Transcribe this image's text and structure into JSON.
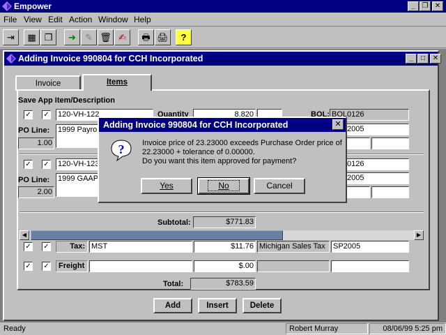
{
  "app": {
    "title": "Empower",
    "window_buttons": [
      "_",
      "❐",
      "✕"
    ]
  },
  "menu": [
    "File",
    "View",
    "Edit",
    "Action",
    "Window",
    "Help"
  ],
  "toolbar": {
    "buttons": [
      {
        "name": "exit-icon",
        "glyph": "⇥"
      },
      {
        "name": "grid-icon",
        "glyph": "▦"
      },
      {
        "name": "windows-icon",
        "glyph": "❐"
      },
      {
        "name": "import-icon",
        "glyph": "➜"
      },
      {
        "name": "eraser-icon",
        "glyph": "✎"
      },
      {
        "name": "trash-icon",
        "glyph": "🗑"
      },
      {
        "name": "signature-icon",
        "glyph": "✍"
      },
      {
        "name": "print-icon",
        "glyph": "🖶"
      },
      {
        "name": "print-preview-icon",
        "glyph": "🖨"
      },
      {
        "name": "help-icon",
        "glyph": "?"
      }
    ]
  },
  "child_window": {
    "title": "Adding Invoice 990804 for CCH Incorporated",
    "tabs": [
      "Invoice",
      "Items"
    ],
    "header": "Save App Item/Description",
    "labels": {
      "quantity": "Quantity",
      "bol": "BOL:",
      "po_line": "PO Line:"
    },
    "items": [
      {
        "item": "120-VH-122",
        "description": "1999 Payroll",
        "po_line": "1.00",
        "quantity": "8.820",
        "bol": "BOL0126",
        "period": "2005",
        "save": true,
        "approve": true
      },
      {
        "item": "120-VH-123",
        "description": "1999 GAAP",
        "po_line": "2.00",
        "quantity": "",
        "bol": "0126",
        "period": "2005",
        "save": true,
        "approve": true
      }
    ],
    "subtotal": {
      "label": "Subtotal:",
      "value": "$771.83"
    },
    "tax": {
      "label": "Tax:",
      "code": "MST",
      "amount": "$11.76",
      "description": "Michigan Sales Tax",
      "period": "SP2005"
    },
    "freight": {
      "label": "Freight",
      "amount": "$.00"
    },
    "total": {
      "label": "Total:",
      "value": "$783.59"
    },
    "buttons": {
      "add": "Add",
      "insert": "Insert",
      "delete": "Delete"
    }
  },
  "dialog": {
    "title": "Adding Invoice 990804 for CCH Incorporated",
    "message_line1": "Invoice price of 23.23000 exceeds Purchase Order price of",
    "message_line2": "22.23000 + tolerance of 0.00000.",
    "message_line3": "Do you want this item approved for payment?",
    "yes": "Yes",
    "no": "No",
    "cancel": "Cancel",
    "close": "✕"
  },
  "status": {
    "text": "Ready",
    "user": "Robert Murray",
    "datetime": "08/06/99 5:25 pm"
  },
  "colors": {
    "titlebar": "#000080",
    "face": "#c0c0c0",
    "desktop": "#808080"
  }
}
